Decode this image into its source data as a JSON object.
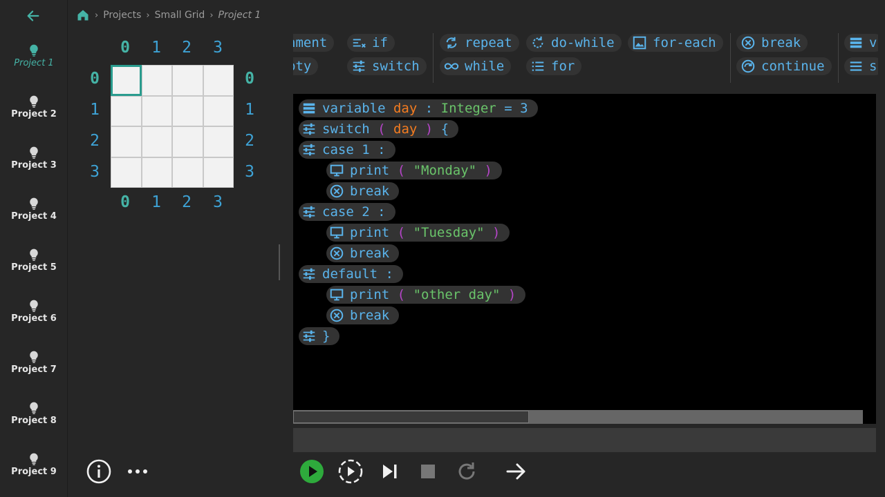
{
  "breadcrumb": {
    "items": [
      "Projects",
      "Small Grid"
    ],
    "current": "Project 1"
  },
  "sidebar": {
    "projects": [
      "Project 1",
      "Project 2",
      "Project 3",
      "Project 4",
      "Project 5",
      "Project 6",
      "Project 7",
      "Project 8",
      "Project 9"
    ],
    "active_index": 0
  },
  "grid": {
    "cols": [
      "0",
      "1",
      "2",
      "3"
    ],
    "rows": [
      "0",
      "1",
      "2",
      "3"
    ],
    "selected": [
      0,
      0
    ]
  },
  "palette": {
    "row1": [
      "nment",
      "if",
      "repeat",
      "do-while",
      "for-each",
      "break",
      "v"
    ],
    "row2": [
      "pty",
      "switch",
      "while",
      "for",
      "continue",
      "s"
    ]
  },
  "code": {
    "l1": {
      "kw": "variable",
      "name": "day",
      "colon": ":",
      "type": "Integer",
      "eq": "=",
      "val": "3"
    },
    "l2": {
      "kw": "switch",
      "open": "(",
      "arg": "day",
      "close": ")",
      "brace": "{"
    },
    "l3": {
      "kw": "case",
      "val": "1",
      "colon": ":"
    },
    "l4": {
      "kw": "print",
      "open": "(",
      "str": "\"Monday\"",
      "close": ")"
    },
    "l5": {
      "kw": "break"
    },
    "l6": {
      "kw": "case",
      "val": "2",
      "colon": ":"
    },
    "l7": {
      "kw": "print",
      "open": "(",
      "str": "\"Tuesday\"",
      "close": ")"
    },
    "l8": {
      "kw": "break"
    },
    "l9": {
      "kw": "default",
      "colon": ":"
    },
    "l10": {
      "kw": "print",
      "open": "(",
      "str": "\"other day\"",
      "close": ")"
    },
    "l11": {
      "kw": "break"
    },
    "l12": {
      "brace": "}"
    }
  },
  "colors": {
    "accent": "#45b3a6",
    "keyword": "#5ab4ec",
    "variable": "#f47c20",
    "string": "#6ac46a",
    "paren": "#b545c8",
    "run": "#2eaa3c"
  },
  "icons": [
    "arrow-left-icon",
    "home-icon",
    "chevron-right-icon",
    "lightbulb-icon",
    "info-icon",
    "more-icon",
    "play-icon",
    "step-over-icon",
    "step-next-icon",
    "stop-icon",
    "reset-icon",
    "arrow-right-icon"
  ]
}
